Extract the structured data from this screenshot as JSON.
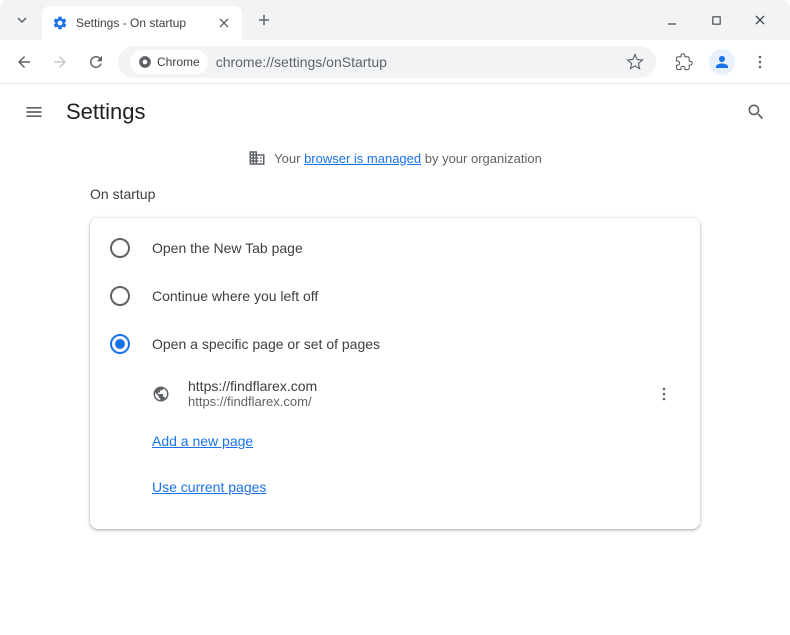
{
  "tab": {
    "title": "Settings - On startup"
  },
  "omnibox": {
    "chip": "Chrome",
    "url": "chrome://settings/onStartup"
  },
  "settings": {
    "title": "Settings",
    "managed_prefix": "Your ",
    "managed_link": "browser is managed",
    "managed_suffix": " by your organization"
  },
  "startup": {
    "heading": "On startup",
    "options": [
      {
        "label": "Open the New Tab page"
      },
      {
        "label": "Continue where you left off"
      },
      {
        "label": "Open a specific page or set of pages"
      }
    ],
    "page": {
      "name": "https://findflarex.com",
      "url": "https://findflarex.com/"
    },
    "add_page": "Add a new page",
    "use_current": "Use current pages"
  }
}
